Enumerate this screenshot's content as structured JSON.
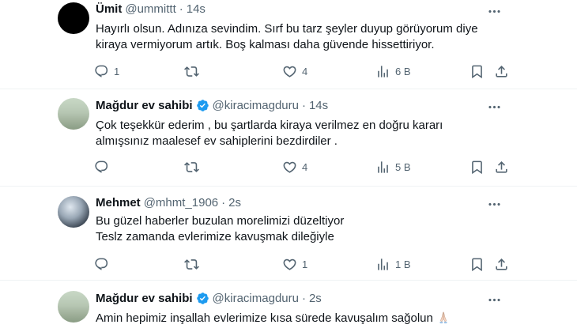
{
  "tweets": [
    {
      "name": "Ümit",
      "handle": "@ummittt",
      "time": "14s",
      "verified": false,
      "lines": [
        "Hayırlı olsun. Adınıza sevindim. Sırf bu tarz şeyler duyup görüyorum diye",
        "kiraya vermiyorum artık. Boş kalması daha güvende hissettiriyor."
      ],
      "replies": "1",
      "retweets": "",
      "likes": "4",
      "views": "6 B"
    },
    {
      "name": "Mağdur ev sahibi",
      "handle": "@kiracimagduru",
      "time": "14s",
      "verified": true,
      "lines": [
        "Çok teşekkür ederim , bu şartlarda kiraya verilmez en doğru kararı",
        "almışsınız maalesef ev sahiplerini bezdirdiler ."
      ],
      "replies": "",
      "retweets": "",
      "likes": "4",
      "views": "5 B"
    },
    {
      "name": "Mehmet",
      "handle": "@mhmt_1906",
      "time": "2s",
      "verified": false,
      "lines": [
        "Bu güzel haberler buzulan morelimizi düzeltiyor",
        "Teslz zamanda evlerimize kavuşmak dileğiyle"
      ],
      "replies": "",
      "retweets": "",
      "likes": "1",
      "views": "1 B"
    },
    {
      "name": "Mağdur ev sahibi",
      "handle": "@kiracimagduru",
      "time": "2s",
      "verified": true,
      "lines": [
        "Amin hepimiz inşallah evlerimize kısa sürede kavuşalım sağolun"
      ],
      "emoji": "folded-hands"
    }
  ],
  "colors": {
    "text": "#0f1419",
    "secondary": "#536471",
    "verified": "#1d9bf0",
    "divider": "#eff3f4"
  },
  "icons": [
    "more-icon",
    "reply-icon",
    "retweet-icon",
    "like-icon",
    "views-icon",
    "bookmark-icon",
    "share-icon",
    "verified-badge-icon"
  ]
}
